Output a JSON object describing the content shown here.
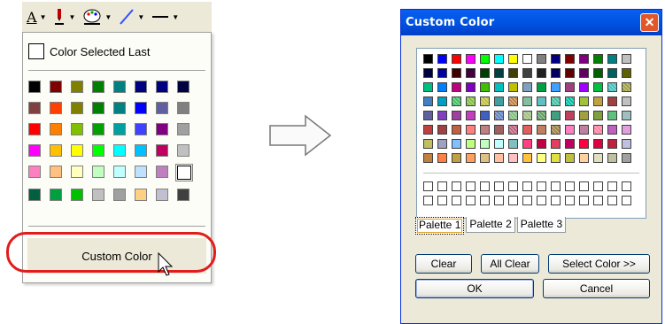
{
  "toolbar": {
    "buttons": [
      {
        "icon": "font-color-icon",
        "glyph": "A"
      },
      {
        "icon": "pen-color-icon"
      },
      {
        "icon": "palette-icon"
      },
      {
        "icon": "line-color-icon"
      },
      {
        "icon": "line-style-icon"
      }
    ]
  },
  "popup": {
    "last_label": "Color Selected Last",
    "swatches": [
      "#000000",
      "#800000",
      "#808000",
      "#008000",
      "#008080",
      "#000080",
      "#000080",
      "#000040",
      "#804040",
      "#ff4000",
      "#808000",
      "#008000",
      "#008080",
      "#0000ff",
      "#6060a0",
      "#808080",
      "#ff0000",
      "#ff8000",
      "#80c000",
      "#00a000",
      "#00a0a0",
      "#4040ff",
      "#800080",
      "#a0a0a0",
      "#ff00ff",
      "#ffc000",
      "#ffff00",
      "#00ff00",
      "#00ffff",
      "#00c0ff",
      "#c00060",
      "#c0c0c0",
      "#ff80c0",
      "#ffc080",
      "#ffffc0",
      "#c0ffc0",
      "#c0ffff",
      "#c0e0ff",
      "#c080c0",
      "#ffffff",
      "#006040",
      "#00a040",
      "#00c000",
      "#c0c0c0",
      "#a0a0a0",
      "#ffd080",
      "#c0c0d0",
      "#404040"
    ],
    "selected_index": 39,
    "custom_label": "Custom Color"
  },
  "dialog": {
    "title": "Custom Color",
    "close_glyph": "✕",
    "palette_rows": [
      [
        "#000000",
        "#0000ff",
        "#ff0000",
        "#ff00ff",
        "#00ff00",
        "#00ffff",
        "#ffff00",
        "#ffffff",
        "#808080",
        "#000080",
        "#800000",
        "#800080",
        "#008000",
        "#008080",
        "#c0c0c0"
      ],
      [
        "#000040",
        "#0000a0",
        "#400000",
        "#400040",
        "#004000",
        "#004040",
        "#404000",
        "#404040",
        "#202020",
        "#000060",
        "#600000",
        "#600060",
        "#006000",
        "#006060",
        "#606000"
      ],
      [
        "#00c080",
        "#0080ff",
        "#c00080",
        "#8000c0",
        "#40c000",
        "#00c0c0",
        "#c0c000",
        "#80a0c0",
        "#00a040",
        "#40a0ff",
        "#a04080",
        "#a000ff",
        "#00c040",
        "#40c0c0",
        "#a0a040"
      ],
      [
        "#4080c0",
        "#00a0c0",
        "#40c060",
        "#80c040",
        "#c0c040",
        "#40a0a0",
        "#c08040",
        "#80c0a0",
        "#60c0c0",
        "#40c0a0",
        "#00c0a0",
        "#a0c040",
        "#c0a040",
        "#a04040",
        "#c0c0c0"
      ],
      [
        "#6060a0",
        "#8040c0",
        "#a040a0",
        "#c040c0",
        "#4060c0",
        "#6080c0",
        "#80c080",
        "#a0c080",
        "#60a060",
        "#40a080",
        "#c04060",
        "#a0a040",
        "#80a040",
        "#60c080",
        "#a0c0c0"
      ],
      [
        "#c04040",
        "#a04040",
        "#c06040",
        "#ff8080",
        "#c08080",
        "#a06060",
        "#c06080",
        "#e06060",
        "#c08060",
        "#a08040",
        "#ff80c0",
        "#c080a0",
        "#ff80a0",
        "#c060c0",
        "#e0a0e0"
      ],
      [
        "#c0c060",
        "#a0a0c0",
        "#80c0ff",
        "#c0ff80",
        "#c0ffc0",
        "#c0ffff",
        "#80c0c0",
        "#ff4080",
        "#c00040",
        "#e04060",
        "#c00060",
        "#ff0040",
        "#e00040",
        "#c02040",
        "#c0c0e0"
      ],
      [
        "#c08040",
        "#ff8040",
        "#c0a040",
        "#ffa060",
        "#e0c080",
        "#ffc0a0",
        "#ffc0c0",
        "#ffc040",
        "#ffff80",
        "#e0e040",
        "#c0c040",
        "#ffd0a0",
        "#e0e0c0",
        "#c0c0a0",
        "#a0a0a0"
      ]
    ],
    "patterned_cells": [
      "3-2",
      "3-3",
      "3-4",
      "3-6",
      "3-9",
      "3-10",
      "4-5",
      "4-6",
      "4-7",
      "4-8",
      "5-6",
      "5-9",
      "5-12",
      "2-13",
      "2-14"
    ],
    "empty_rows": 2,
    "tabs": [
      "Palette 1",
      "Palette 2",
      "Palette 3"
    ],
    "active_tab": 0,
    "buttons": {
      "clear": "Clear",
      "all_clear": "All Clear",
      "select_color": "Select Color >>",
      "ok": "OK",
      "cancel": "Cancel"
    }
  }
}
